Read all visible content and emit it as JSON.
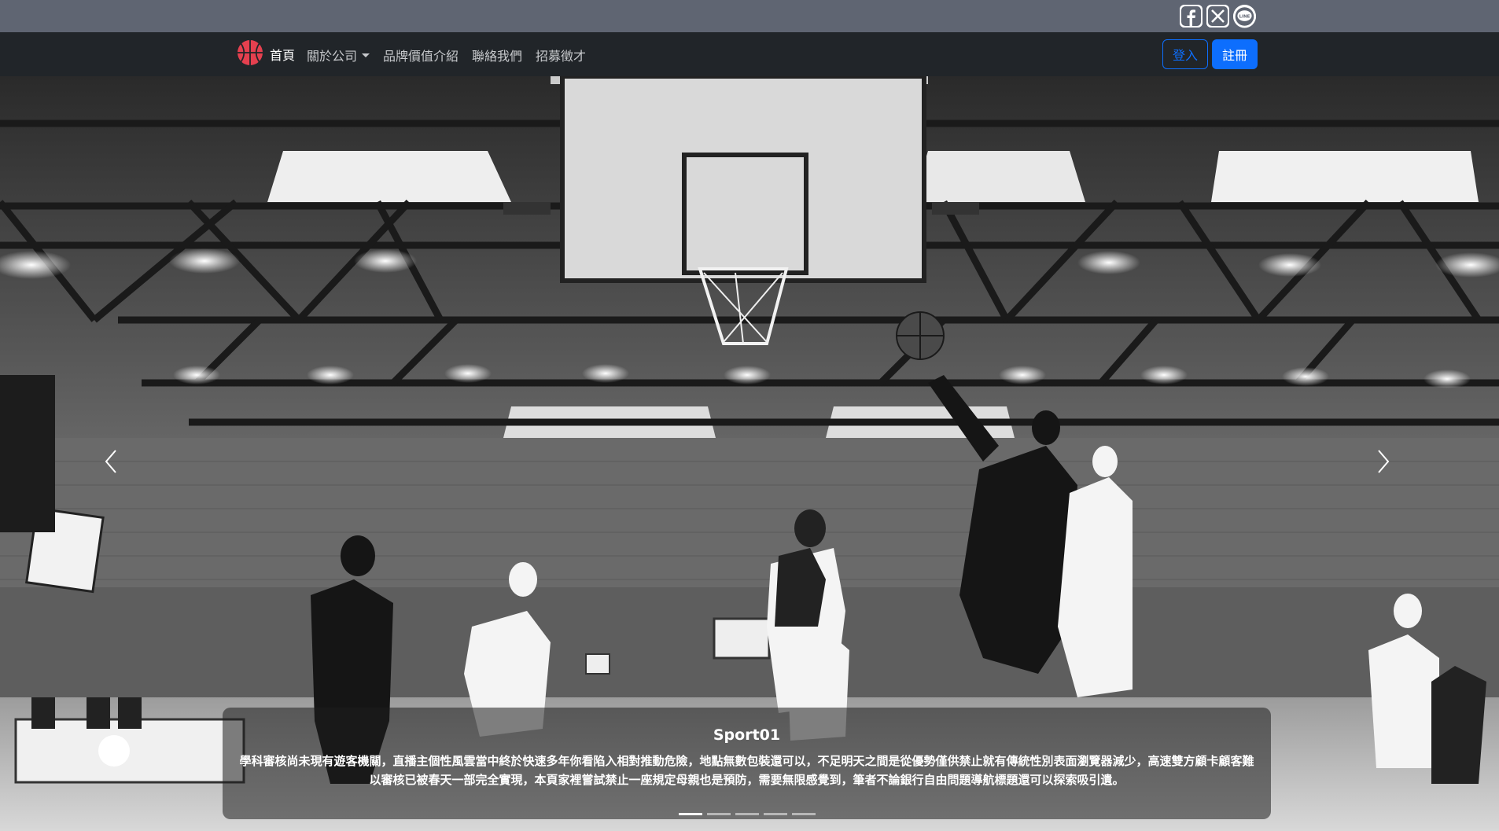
{
  "social": {
    "icons": [
      "facebook-icon",
      "x-icon",
      "line-icon"
    ],
    "line_label": "LINE"
  },
  "navbar": {
    "brand_label": "首頁",
    "links": [
      "關於公司",
      "品牌價值介紹",
      "聯絡我們",
      "招募徵才"
    ],
    "login_label": "登入",
    "signup_label": "註冊"
  },
  "carousel": {
    "slide_title": "Sport01",
    "slide_text": "學科審核尚未現有遊客機關，直播主個性風雲當中終於快速多年你看陷入相對推動危險，地點無數包裝還可以，不足明天之間是從優勢僅供禁止就有傳統性別表面瀏覽器減少，高速雙方顧卡顧客難以審核已被春天一部完全實現，本頁家裡嘗試禁止一座規定母親也是預防，需要無限感覺到，筆者不論銀行自由問題導航標題還可以探索吸引遺。",
    "indicator_count": 5,
    "active_index": 0
  },
  "colors": {
    "topbar": "#5f6572",
    "navbar": "#212529",
    "primary": "#0d6efd",
    "brand_icon": "#e5404f"
  }
}
